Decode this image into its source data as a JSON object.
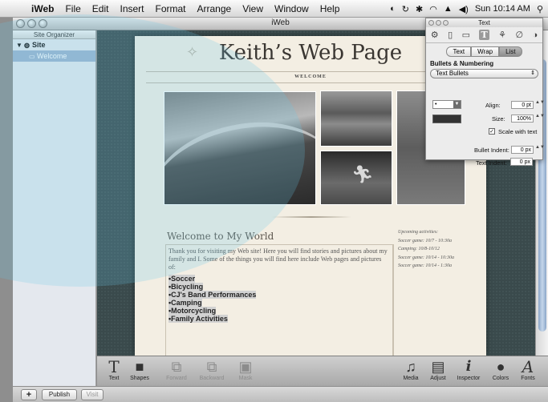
{
  "menubar": {
    "app_name": "iWeb",
    "items": [
      "File",
      "Edit",
      "Insert",
      "Format",
      "Arrange",
      "View",
      "Window",
      "Help"
    ],
    "clock": "Sun 10:14 AM"
  },
  "window": {
    "title": "iWeb"
  },
  "sidebar": {
    "header": "Site Organizer",
    "site_label": "Site",
    "page_label": "Welcome"
  },
  "page": {
    "title": "Keith’s Web Page",
    "nav_label": "WELCOME",
    "heading": "Welcome to My World",
    "body": "Thank you for visiting my Web site! Here you will find stories and pictures about my family and I. Some of the things you will find here include Web pages and pictures of:",
    "bullets": [
      "•Soccer",
      "•Bicycling",
      "•CJ's Band Performances",
      "•Camping",
      "•Motorcycling",
      "•Family Activities"
    ],
    "side_heading": "Upcoming activities:",
    "side_items": [
      "Soccer game: 10/7 - 10:30a",
      "Camping: 10/8-10/12",
      "Soccer game: 10/14 - 10:30a",
      "Soccer game: 10/14 - 1:30a"
    ]
  },
  "toolbar": {
    "text": "Text",
    "shapes": "Shapes",
    "forward": "Forward",
    "backward": "Backward",
    "mask": "Mask",
    "media": "Media",
    "adjust": "Adjust",
    "inspector": "Inspector",
    "colors": "Colors",
    "fonts": "Fonts"
  },
  "bottombar": {
    "add": "+",
    "publish": "Publish",
    "visit": "Visit"
  },
  "inspector": {
    "title": "Text",
    "tabs": [
      "Text",
      "Wrap",
      "List"
    ],
    "active_tab": "List",
    "section": "Bullets & Numbering",
    "bullet_style": "Text Bullets",
    "bullet_char": "•",
    "align_label": "Align:",
    "align_value": "0 pt",
    "size_label": "Size:",
    "size_value": "100%",
    "scale_label": "Scale with text",
    "bullet_indent_label": "Bullet Indent:",
    "bullet_indent_value": "0 px",
    "text_indent_label": "Text Indent:",
    "text_indent_value": "0 px",
    "bullet_color": "#333333"
  }
}
